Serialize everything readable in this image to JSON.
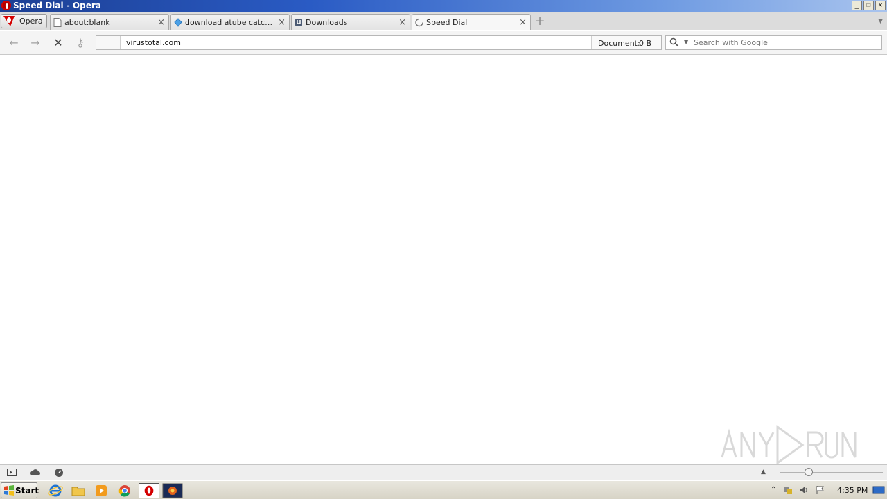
{
  "window": {
    "title": "Speed Dial - Opera",
    "minimize_glyph": "_",
    "restore_glyph": "❐",
    "close_glyph": "✕"
  },
  "menu": {
    "label": "Opera"
  },
  "tabs": [
    {
      "label": "about:blank",
      "icon": "page-icon",
      "active": false
    },
    {
      "label": "download atube catcher …",
      "icon": "diamond-icon",
      "active": false
    },
    {
      "label": "Downloads",
      "icon": "downloads-icon",
      "active": false
    },
    {
      "label": "Speed Dial",
      "icon": "loading-spinner-icon",
      "active": true
    }
  ],
  "tab_close_glyph": "×",
  "new_tab_glyph": "+",
  "toolbar": {
    "back_glyph": "←",
    "forward_glyph": "→",
    "stop_glyph": "✕",
    "key_glyph": "⚷"
  },
  "address": {
    "url": "virustotal.com",
    "document_label": "Document:",
    "document_size": "0 B"
  },
  "search": {
    "placeholder": "Search with Google"
  },
  "taskbar": {
    "start_label": "Start",
    "clock": "4:35 PM",
    "apps": [
      "internet-explorer-icon",
      "folder-icon",
      "media-player-icon",
      "chrome-icon",
      "opera-icon",
      "app-icon"
    ]
  },
  "colors": {
    "title_bar": "#2a5bc4",
    "opera_red": "#d40000"
  }
}
